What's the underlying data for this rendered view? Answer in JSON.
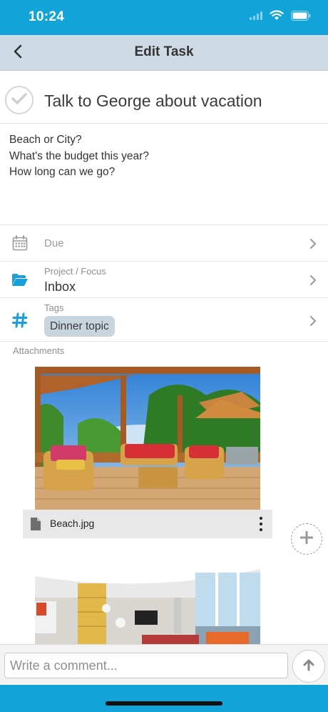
{
  "status_bar": {
    "time": "10:24"
  },
  "navbar": {
    "title": "Edit Task",
    "back_icon": "chevron-left-icon"
  },
  "task": {
    "title": "Talk to George about vacation",
    "completed": false,
    "notes": [
      "Beach or City?",
      "What's the budget this year?",
      "How long can we go?"
    ]
  },
  "fields": {
    "due": {
      "placeholder": "Due",
      "icon": "calendar-icon"
    },
    "project": {
      "label": "Project / Focus",
      "value": "Inbox",
      "icon": "folder-open-icon"
    },
    "tags": {
      "label": "Tags",
      "items": [
        "Dinner topic"
      ],
      "icon": "hashtag-icon"
    }
  },
  "attachments": {
    "label": "Attachments",
    "items": [
      {
        "file_name": "Beach.jpg",
        "image": "patio-photo"
      },
      {
        "file_name": "",
        "image": "interior-photo"
      }
    ]
  },
  "comment": {
    "placeholder": "Write a comment..."
  },
  "colors": {
    "accent": "#12a3d8",
    "navbar": "#cfdbe4",
    "icon_blue": "#1a9fd8",
    "tag_chip": "#c9d5de"
  }
}
